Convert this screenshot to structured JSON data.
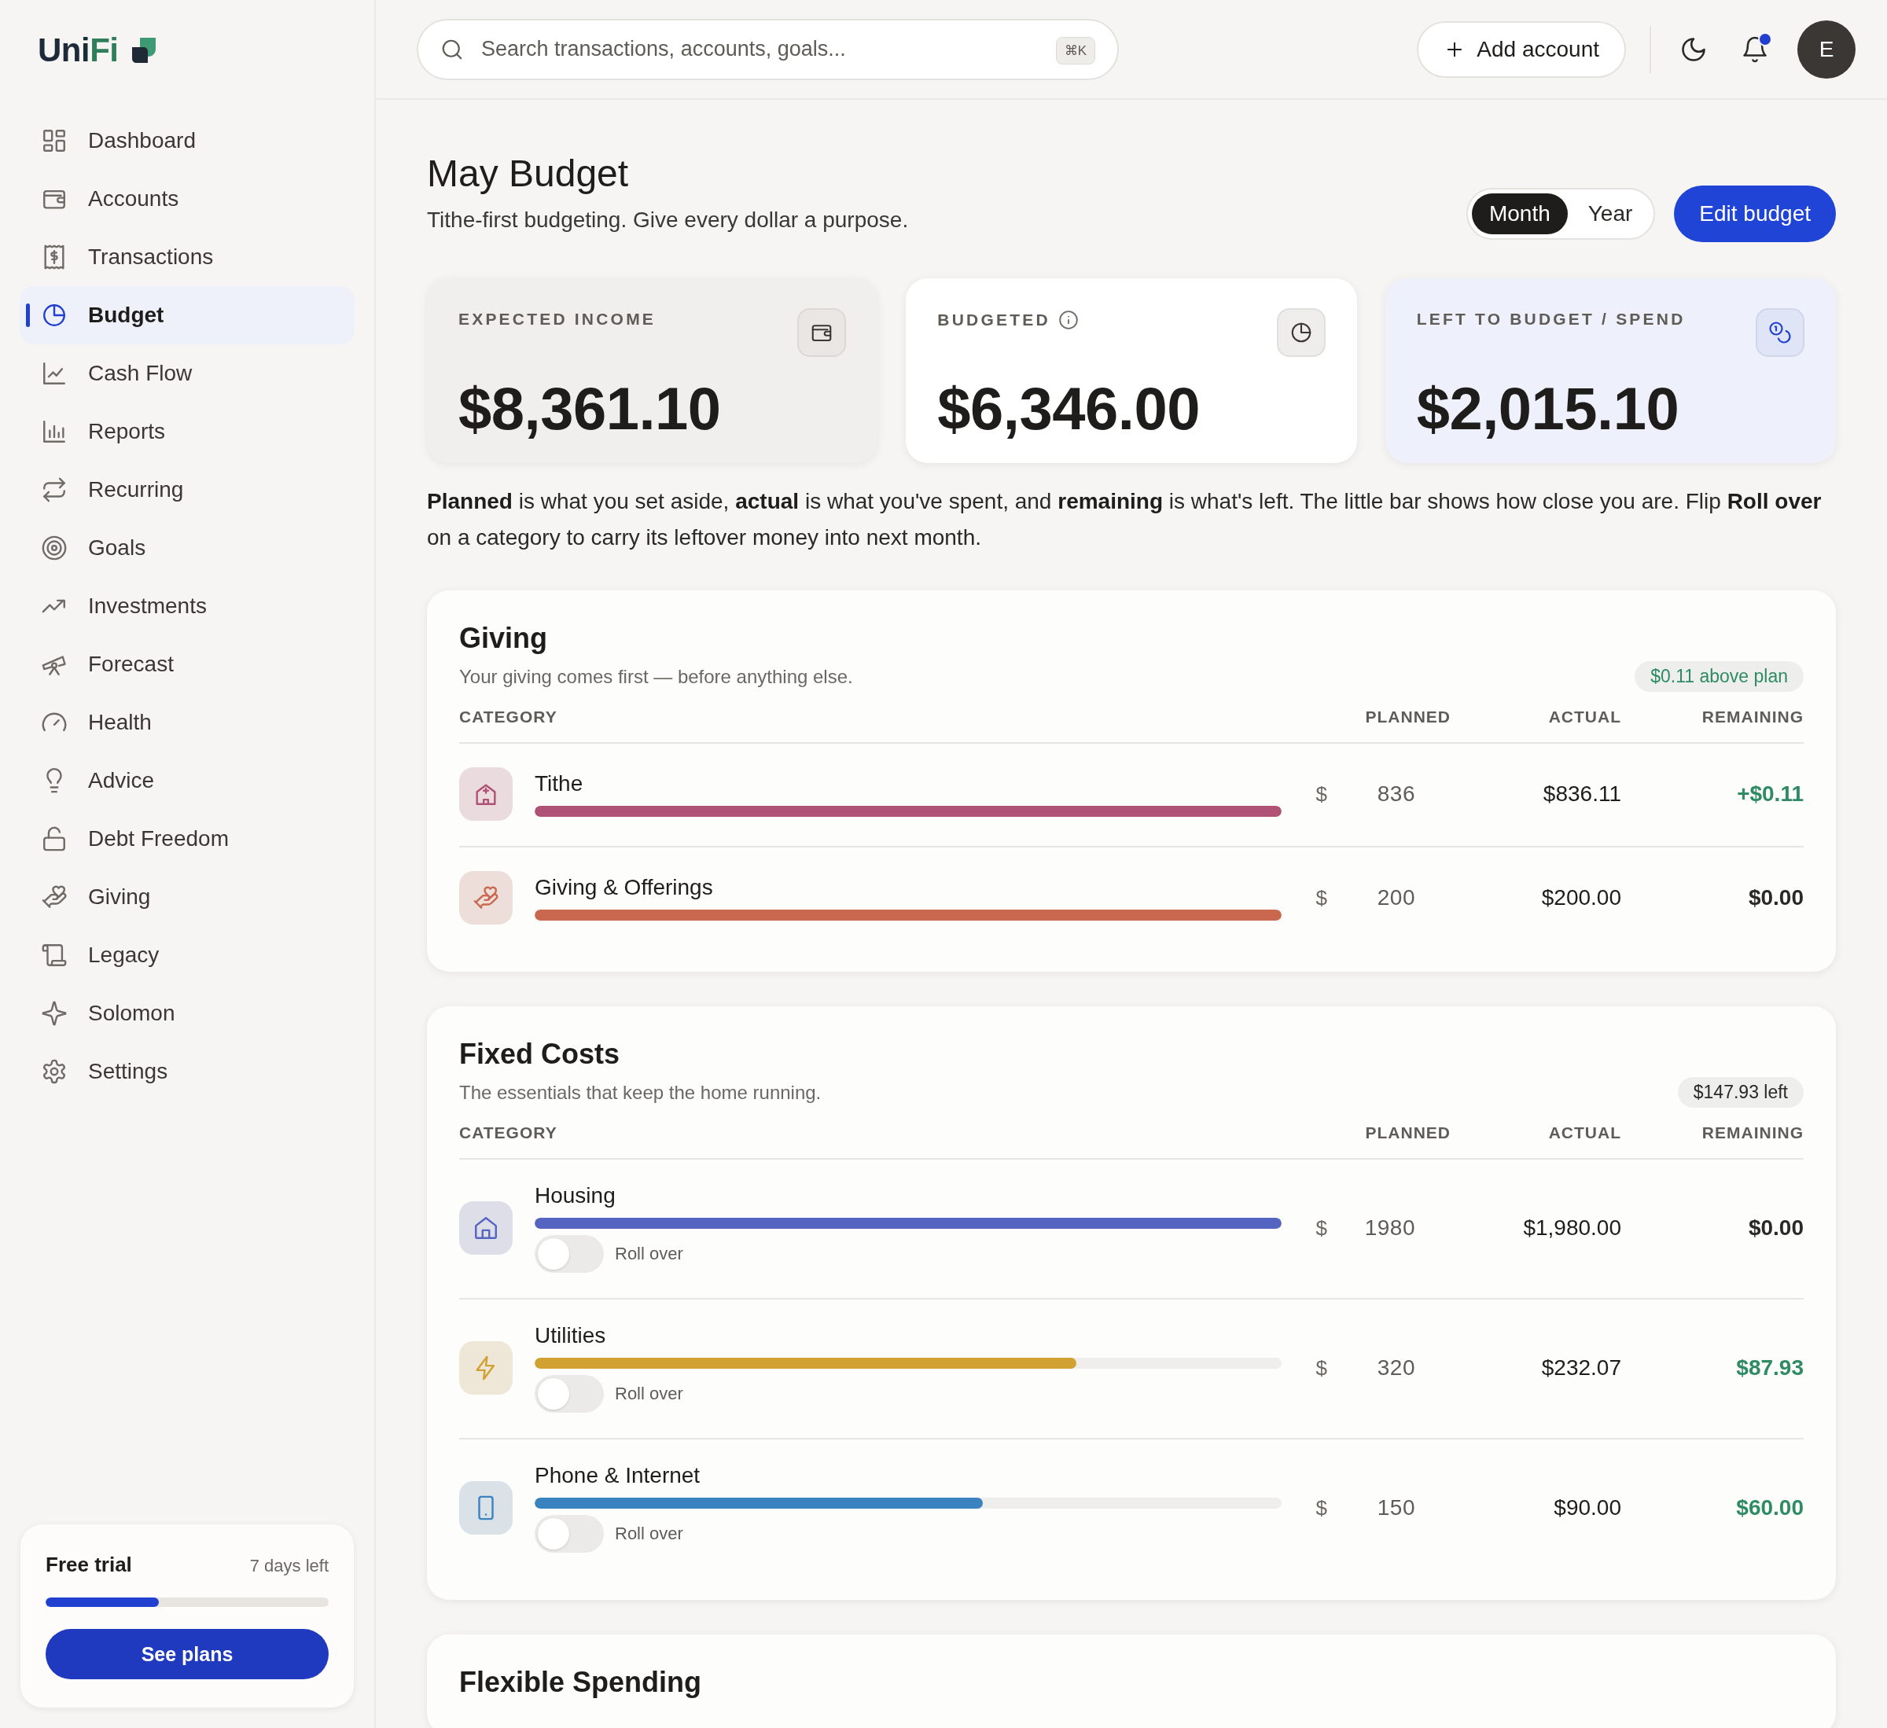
{
  "brand": {
    "name": "UniFi"
  },
  "nav": {
    "items": [
      {
        "label": "Dashboard",
        "selected": false
      },
      {
        "label": "Accounts",
        "selected": false
      },
      {
        "label": "Transactions",
        "selected": false
      },
      {
        "label": "Budget",
        "selected": true
      },
      {
        "label": "Cash Flow",
        "selected": false
      },
      {
        "label": "Reports",
        "selected": false
      },
      {
        "label": "Recurring",
        "selected": false
      },
      {
        "label": "Goals",
        "selected": false
      },
      {
        "label": "Investments",
        "selected": false
      },
      {
        "label": "Forecast",
        "selected": false
      },
      {
        "label": "Health",
        "selected": false
      },
      {
        "label": "Advice",
        "selected": false
      },
      {
        "label": "Debt Freedom",
        "selected": false
      },
      {
        "label": "Giving",
        "selected": false
      },
      {
        "label": "Legacy",
        "selected": false
      },
      {
        "label": "Solomon",
        "selected": false
      },
      {
        "label": "Settings",
        "selected": false
      }
    ]
  },
  "trial": {
    "title": "Free trial",
    "days_left": "7 days left",
    "level": 0.4,
    "button": "See plans"
  },
  "header": {
    "search_placeholder": "Search transactions, accounts, goals...",
    "shortcut": "⌘K",
    "add_button": "Add account",
    "unread": true,
    "avatar": "E"
  },
  "page": {
    "title": "May Budget",
    "subtitle": "Tithe-first budgeting. Give every dollar a purpose.",
    "periods": [
      {
        "label": "Month",
        "selected": true
      },
      {
        "label": "Year",
        "selected": false
      }
    ],
    "edit_button": "Edit budget"
  },
  "summary": [
    {
      "kind": "income",
      "label": "EXPECTED INCOME",
      "value": "$8,361.10",
      "info": false
    },
    {
      "kind": "budgeted",
      "label": "BUDGETED",
      "value": "$6,346.00",
      "info": true
    },
    {
      "kind": "left",
      "label": "LEFT TO BUDGET / SPEND",
      "value": "$2,015.10",
      "info": false
    }
  ],
  "explainer": "**Planned** is what you set aside, **actual** is what you've spent, and **remaining** is what's left. The little bar shows how close you are. Flip **Roll over** on a category to carry its leftover money into next month.",
  "sections": [
    {
      "title": "Giving",
      "subtitle": "Your giving comes first — before anything else.",
      "badge": "$0.11 above plan",
      "badge_positive": true,
      "columns": [
        "CATEGORY",
        "PLANNED",
        "ACTUAL",
        "REMAINING"
      ],
      "rows": [
        {
          "name": "Tithe",
          "level": 1,
          "color": "#b05276",
          "currency": "$",
          "planned": "836",
          "actual": "$836.11",
          "remaining": "+$0.11",
          "positive": true
        },
        {
          "name": "Giving & Offerings",
          "level": 1,
          "color": "#c9684f",
          "currency": "$",
          "planned": "200",
          "actual": "$200.00",
          "remaining": "$0.00",
          "positive": false
        }
      ]
    },
    {
      "title": "Fixed Costs",
      "subtitle": "The essentials that keep the home running.",
      "badge": "$147.93 left",
      "badge_positive": false,
      "columns": [
        "CATEGORY",
        "PLANNED",
        "ACTUAL",
        "REMAINING"
      ],
      "rows": [
        {
          "name": "Housing",
          "level": 1,
          "color": "#5563c1",
          "currency": "$",
          "planned": "1980",
          "actual": "$1,980.00",
          "remaining": "$0.00",
          "positive": false,
          "rollover_label": "Roll over",
          "rollover_on": false
        },
        {
          "name": "Utilities",
          "level": 0.725,
          "color": "#d1a132",
          "currency": "$",
          "planned": "320",
          "actual": "$232.07",
          "remaining": "$87.93",
          "positive": true,
          "rollover_label": "Roll over",
          "rollover_on": false
        },
        {
          "name": "Phone & Internet",
          "level": 0.6,
          "color": "#3b82c0",
          "currency": "$",
          "planned": "150",
          "actual": "$90.00",
          "remaining": "$60.00",
          "positive": true,
          "rollover_label": "Roll over",
          "rollover_on": false
        }
      ]
    },
    {
      "title": "Flexible Spending"
    }
  ]
}
